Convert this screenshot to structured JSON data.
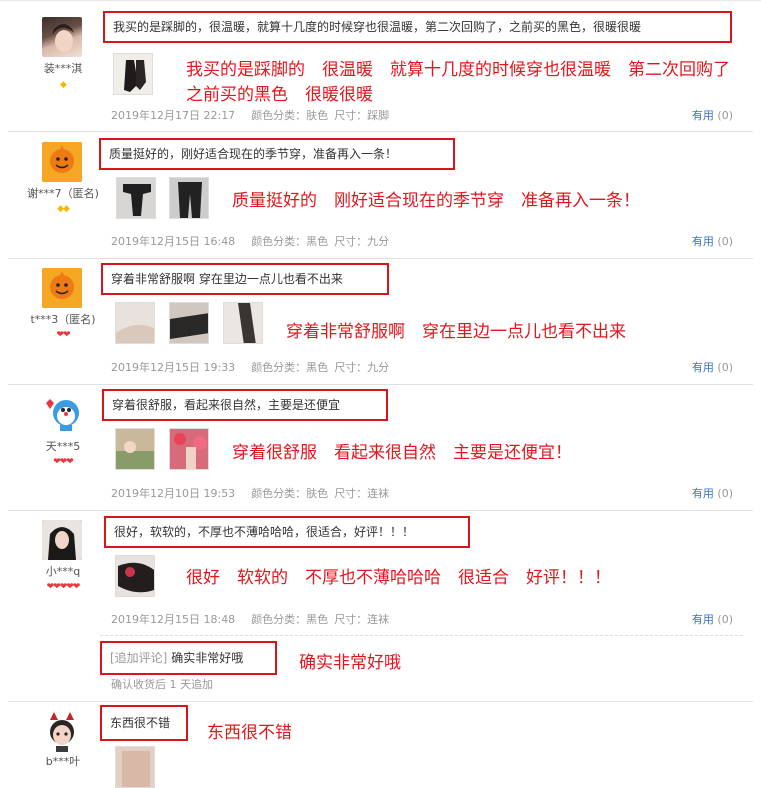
{
  "reviews": [
    {
      "user": {
        "name": "装***淇",
        "level": "◆"
      },
      "content": "我买的是踩脚的，很温暖，就算十几度的时候穿也很温暖，第二次回购了，之前买的黑色，很暖很暖",
      "annotation": "我买的是踩脚的　很温暖　就算十几度的时候穿也很温暖　第二次回购了　之前买的黑色　很暖很暖",
      "date": "2019年12月17日 22:17",
      "color_label": "颜色分类：肤色",
      "size_label": "尺寸：踩脚",
      "useful_label": "有用",
      "useful_count": "(0)"
    },
    {
      "user": {
        "name": "谢***7（匿名)",
        "level": "◆◆"
      },
      "content": "质量挺好的，刚好适合现在的季节穿，准备再入一条！",
      "annotation": "质量挺好的　刚好适合现在的季节穿　准备再入一条！",
      "date": "2019年12月15日 16:48",
      "color_label": "颜色分类：黑色",
      "size_label": "尺寸：九分",
      "useful_label": "有用",
      "useful_count": "(0)"
    },
    {
      "user": {
        "name": "t***3（匿名)",
        "level": "❤❤"
      },
      "content": "穿着非常舒服啊 穿在里边一点儿也看不出来",
      "annotation": "穿着非常舒服啊　穿在里边一点儿也看不出来",
      "date": "2019年12月15日 19:33",
      "color_label": "颜色分类：黑色",
      "size_label": "尺寸：九分",
      "useful_label": "有用",
      "useful_count": "(0)"
    },
    {
      "user": {
        "name": "天***5",
        "level": "❤❤❤"
      },
      "content": "穿着很舒服，看起来很自然，主要是还便宜",
      "annotation": "穿着很舒服　看起来很自然　主要是还便宜！",
      "date": "2019年12月10日 19:53",
      "color_label": "颜色分类：肤色",
      "size_label": "尺寸：连袜",
      "useful_label": "有用",
      "useful_count": "(0)"
    },
    {
      "user": {
        "name": "小***q",
        "level": "❤❤❤❤❤"
      },
      "content": "很好，软软的，不厚也不薄哈哈哈，很适合，好评！！！",
      "annotation": "很好　软软的　不厚也不薄哈哈哈　很适合　好评！！！",
      "date": "2019年12月15日 18:48",
      "color_label": "颜色分类：黑色",
      "size_label": "尺寸：连袜",
      "useful_label": "有用",
      "useful_count": "(0)",
      "append": {
        "tag": "[追加评论]",
        "text": "确实非常好哦",
        "annotation": "确实非常好哦",
        "note": "确认收货后 1 天追加"
      }
    },
    {
      "user": {
        "name": "b***叶"
      },
      "content": "东西很不错",
      "annotation": "东西很不错"
    }
  ],
  "colors": {
    "red": "#e3161d",
    "link": "#3b73c8",
    "meta": "#999999"
  }
}
